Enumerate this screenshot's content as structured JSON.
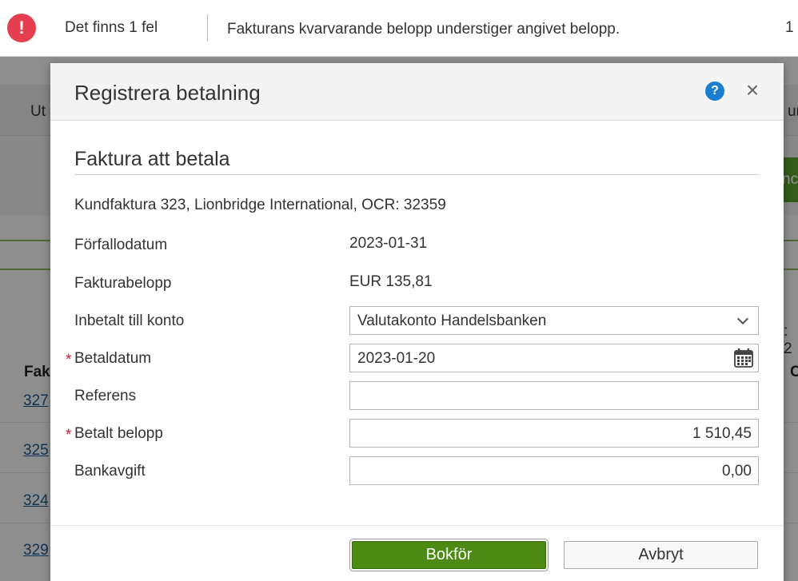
{
  "error_bar": {
    "count_text": "Det finns 1 fel",
    "message": "Fakturans kvarvarande belopp understiger angivet belopp.",
    "trailing_number": "1",
    "icon": "exclamation-icon",
    "icon_color": "#e53f4f"
  },
  "background": {
    "tab_left_fragment": "Ut",
    "tab_right_fragment": "ur",
    "green_button_fragment": "nc",
    "side_fragment": ": 2",
    "column_head_left": "Fak",
    "column_head_right": "C",
    "row_links": [
      "327",
      "325",
      "324",
      "329"
    ]
  },
  "modal": {
    "title": "Registrera betalning",
    "help_icon_glyph": "?",
    "close_icon_glyph": "×",
    "section_title": "Faktura att betala",
    "invoice_reference": "Kundfaktura 323, Lionbridge International, OCR: 32359",
    "fields": {
      "due_date": {
        "label": "Förfallodatum",
        "value": "2023-01-31"
      },
      "invoice_amount": {
        "label": "Fakturabelopp",
        "value": "EUR 135,81"
      },
      "deposit_account": {
        "label": "Inbetalt till konto",
        "value": "Valutakonto Handelsbanken"
      },
      "payment_date": {
        "label": "Betaldatum",
        "value": "2023-01-20",
        "required": "*"
      },
      "reference": {
        "label": "Referens",
        "value": ""
      },
      "paid_amount": {
        "label": "Betalt belopp",
        "value": "1 510,45",
        "required": "*"
      },
      "bank_fee": {
        "label": "Bankavgift",
        "value": "0,00"
      }
    },
    "buttons": {
      "primary": "Bokför",
      "secondary": "Avbryt"
    },
    "colors": {
      "primary_button": "#4c8a14",
      "help_icon": "#1a7fd1",
      "required_marker": "#d01e2b"
    }
  }
}
